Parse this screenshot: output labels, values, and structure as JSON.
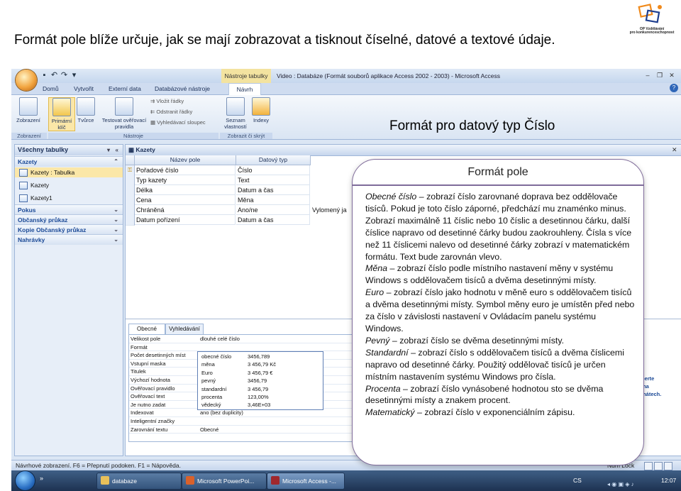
{
  "slide": {
    "title": "Formát pole blíže určuje, jak se mají zobrazovat a tisknout číselné, datové a textové údaje.",
    "heading": "Formát pro datový typ Číslo",
    "logo_text": "OP Vzdělávání pro konkurenceschopnost"
  },
  "window": {
    "title": "Video : Databáze (Formát souborů aplikace Access 2002 - 2003) - Microsoft Access",
    "context_tab": "Nástroje tabulky"
  },
  "ribbon": {
    "tabs": [
      "Domů",
      "Vytvořit",
      "Externí data",
      "Databázové nástroje"
    ],
    "active_tab": "Návrh",
    "buttons": {
      "zobrazeni": "Zobrazení",
      "primarni": "Primární klíč",
      "tvurce": "Tvůrce",
      "testovat": "Testovat ověřovací pravidla",
      "vlozit": "Vložit řádky",
      "odstranit": "Odstranit řádky",
      "vyhledavaci": "Vyhledávací sloupec",
      "seznam": "Seznam vlastností",
      "indexy": "Indexy"
    },
    "groups": [
      "Zobrazení",
      "Nástroje",
      "Zobrazit či skrýt"
    ]
  },
  "nav": {
    "header": "Všechny tabulky",
    "items": [
      {
        "label": "Kazety",
        "type": "group"
      },
      {
        "label": "Kazety : Tabulka",
        "type": "object",
        "selected": true
      },
      {
        "label": "Kazety",
        "type": "object"
      },
      {
        "label": "Kazety1",
        "type": "object"
      },
      {
        "label": "Pokus",
        "type": "group"
      },
      {
        "label": "Občanský průkaz",
        "type": "group"
      },
      {
        "label": "Kopie Občanský průkaz",
        "type": "group"
      },
      {
        "label": "Nahrávky",
        "type": "group"
      }
    ]
  },
  "design": {
    "tab": "Kazety",
    "col_name": "Název pole",
    "col_type": "Datový typ",
    "rows": [
      {
        "name": "Pořadové číslo",
        "type": "Číslo",
        "desc": ""
      },
      {
        "name": "Typ kazety",
        "type": "Text",
        "desc": ""
      },
      {
        "name": "Délka",
        "type": "Datum a čas",
        "desc": ""
      },
      {
        "name": "Cena",
        "type": "Měna",
        "desc": ""
      },
      {
        "name": "Chráněná",
        "type": "Ano/ne",
        "desc": "Vylomený ja"
      },
      {
        "name": "Datum pořízení",
        "type": "Datum a čas",
        "desc": ""
      }
    ]
  },
  "props": {
    "tabs": [
      "Obecné",
      "Vyhledávání"
    ],
    "rows": [
      {
        "label": "Velikost pole",
        "value": "dlouhé celé číslo"
      },
      {
        "label": "Formát",
        "value": ""
      },
      {
        "label": "Počet desetinných míst",
        "value": ""
      },
      {
        "label": "Vstupní maska",
        "value": ""
      },
      {
        "label": "Titulek",
        "value": ""
      },
      {
        "label": "Výchozí hodnota",
        "value": ""
      },
      {
        "label": "Ověřovací pravidlo",
        "value": ""
      },
      {
        "label": "Ověřovací text",
        "value": ""
      },
      {
        "label": "Je nutno zadat",
        "value": ""
      },
      {
        "label": "Indexovat",
        "value": "ano (bez duplicity)"
      },
      {
        "label": "Inteligentní značky",
        "value": ""
      },
      {
        "label": "Zarovnání textu",
        "value": "Obecné"
      }
    ],
    "format_options": [
      {
        "name": "obecné číslo",
        "example": "3456,789"
      },
      {
        "name": "měna",
        "example": "3 456,79 Kč"
      },
      {
        "name": "Euro",
        "example": "3 456,79 €"
      },
      {
        "name": "pevný",
        "example": "3456,79"
      },
      {
        "name": "standardní",
        "example": "3 456,79"
      },
      {
        "name": "procenta",
        "example": "123,00%"
      },
      {
        "name": "vědecký",
        "example": "3,46E+03"
      }
    ],
    "hint": [
      "berte",
      "ma",
      "mátech."
    ]
  },
  "status": {
    "text": "Návrhové zobrazení. F6 = Přepnutí podoken. F1 = Nápověda.",
    "numlock": "Num Lock"
  },
  "taskbar": {
    "buttons": [
      "databaze",
      "Microsoft PowerPoi...",
      "Microsoft Access -..."
    ],
    "lang": "CS",
    "clock": "12:07"
  },
  "callout": {
    "title": "Formát pole",
    "items": [
      {
        "term": "Obecné číslo",
        "text": " – zobrazí číslo zarovnané doprava bez oddělovače tisíců. Pokud je toto číslo záporné, předchází mu znaménko minus. Zobrazí maximálně 11 číslic nebo 10 číslic a desetinnou čárku, další číslice napravo od desetinné čárky budou zaokrouhleny. Čísla s více než 11 číslicemi nalevo od desetinné čárky zobrazí v matematickém formátu. Text bude zarovnán vlevo."
      },
      {
        "term": "Měna",
        "text": " – zobrazí číslo podle místního nastavení měny v systému Windows s oddělovačem tisíců a dvěma desetinnými místy."
      },
      {
        "term": "Euro",
        "text": " – zobrazí číslo jako hodnotu v měně euro s oddělovačem tisíců a dvěma desetinnými místy. Symbol měny euro je umístěn před nebo za číslo v závislosti nastavení v Ovládacím panelu systému Windows."
      },
      {
        "term": "Pevný",
        "text": " – zobrazí číslo se dvěma desetinnými místy."
      },
      {
        "term": "Standardní",
        "text": " – zobrazí číslo s oddělovačem tisíců a dvěma číslicemi napravo od desetinné čárky. Použitý oddělovač tisíců je určen místním nastavením systému Windows pro čísla."
      },
      {
        "term": "Procenta",
        "text": " – zobrazí číslo vynásobené hodnotou sto se dvěma desetinnými místy a znakem procent."
      },
      {
        "term": "Matematický",
        "text": " – zobrazí číslo v exponenciálním zápisu."
      }
    ]
  }
}
